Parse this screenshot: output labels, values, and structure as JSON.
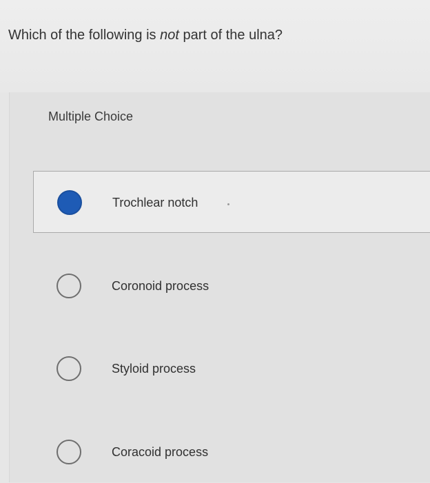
{
  "question": {
    "prefix": "Which of the following is ",
    "emphasis": "not",
    "suffix": " part of the ulna?"
  },
  "question_type": "Multiple Choice",
  "options": [
    {
      "label": "Trochlear notch",
      "selected": true
    },
    {
      "label": "Coronoid process",
      "selected": false
    },
    {
      "label": "Styloid process",
      "selected": false
    },
    {
      "label": "Coracoid process",
      "selected": false
    }
  ],
  "colors": {
    "selected_radio": "#1e5bb5",
    "selected_option_bg": "#ececec",
    "page_bg": "#e6e6e6"
  }
}
